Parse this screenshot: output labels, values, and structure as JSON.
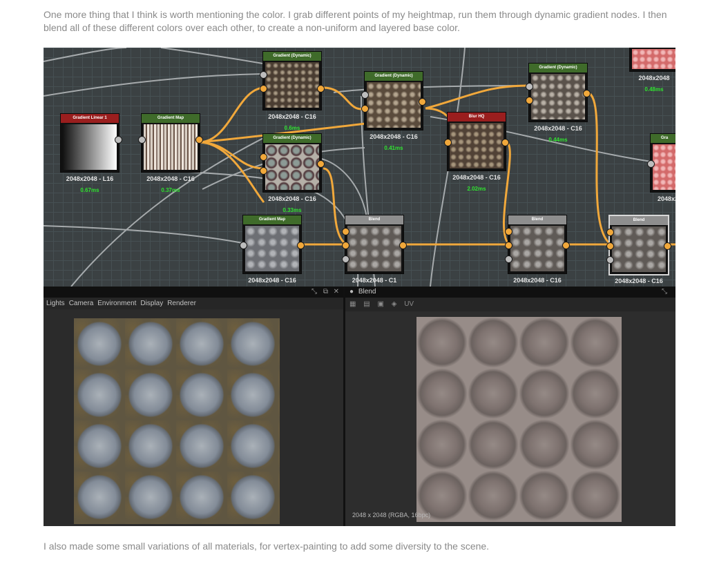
{
  "article": {
    "intro": "One more thing that I think is worth mentioning the color. I grab different points of my heightmap, run them through dynamic gradient nodes. I then blend all of these different colors over each other, to create a non-uniform and layered base color.",
    "outro": "I also made some small variations of all materials, for vertex-painting to add some diversity to the scene."
  },
  "graph": {
    "nodes": [
      {
        "id": "gradient-linear-1",
        "title": "Gradient Linear 1",
        "header_color": "#9a1e1e",
        "res": "2048x2048 - L16",
        "time": "0.67ms",
        "thumb": "linear"
      },
      {
        "id": "gradient-map-1",
        "title": "Gradient Map",
        "header_color": "#3f6b2a",
        "res": "2048x2048 - C16",
        "time": "0.37ms",
        "thumb": "stripes"
      },
      {
        "id": "gradient-dynamic-1",
        "title": "Gradient (Dynamic)",
        "header_color": "#3f6b2a",
        "res": "2048x2048 - C16",
        "time": "0.6ms",
        "thumb": "noise-tan"
      },
      {
        "id": "gradient-dynamic-2",
        "title": "Gradient (Dynamic)",
        "header_color": "#3f6b2a",
        "res": "2048x2048 - C16",
        "time": "0.33ms",
        "thumb": "cells"
      },
      {
        "id": "gradient-dynamic-3",
        "title": "Gradient (Dynamic)",
        "header_color": "#3f6b2a",
        "res": "2048x2048 - C16",
        "time": "0.41ms",
        "thumb": "noise-tan"
      },
      {
        "id": "blur-hq",
        "title": "Blur HQ",
        "header_color": "#9a1e1e",
        "res": "2048x2048 - C16",
        "time": "2.02ms",
        "thumb": "noise-tan"
      },
      {
        "id": "gradient-dynamic-4",
        "title": "Gradient (Dynamic)",
        "header_color": "#3f6b2a",
        "res": "2048x2048 - C16",
        "time": "0.44ms",
        "thumb": "noise-grey"
      },
      {
        "id": "top-right-node",
        "title": "",
        "header_color": "#9a1e1e",
        "res": "2048x2048",
        "time": "0.48ms",
        "thumb": "pink"
      },
      {
        "id": "right-node",
        "title": "Gra",
        "header_color": "#3f6b2a",
        "res": "2048x2",
        "time": "",
        "thumb": "pink"
      },
      {
        "id": "gradient-map-2",
        "title": "Gradient Map",
        "header_color": "#3f6b2a",
        "res": "2048x2048 - C16",
        "time": "",
        "thumb": "stone"
      },
      {
        "id": "blend-1",
        "title": "Blend",
        "header_color": "#8e8e8e",
        "res": "2048x2048 - C1",
        "time": "",
        "thumb": "stone"
      },
      {
        "id": "blend-2",
        "title": "Blend",
        "header_color": "#8e8e8e",
        "res": "2048x2048 - C16",
        "time": "",
        "thumb": "stone"
      },
      {
        "id": "blend-3",
        "title": "Blend",
        "header_color": "#8e8e8e",
        "res": "2048x2048 - C16",
        "time": "",
        "thumb": "stone"
      }
    ]
  },
  "view3d": {
    "menu": [
      "Lights",
      "Camera",
      "Environment",
      "Display",
      "Renderer"
    ]
  },
  "view2d": {
    "title": "Blend",
    "tools_uv": "UV",
    "info": "2048 x 2048 (RGBA, 16bpc)"
  },
  "colors": {
    "accent_wire": "#f1a83b",
    "time_green": "#31e431",
    "graph_bg": "#3b4143"
  }
}
